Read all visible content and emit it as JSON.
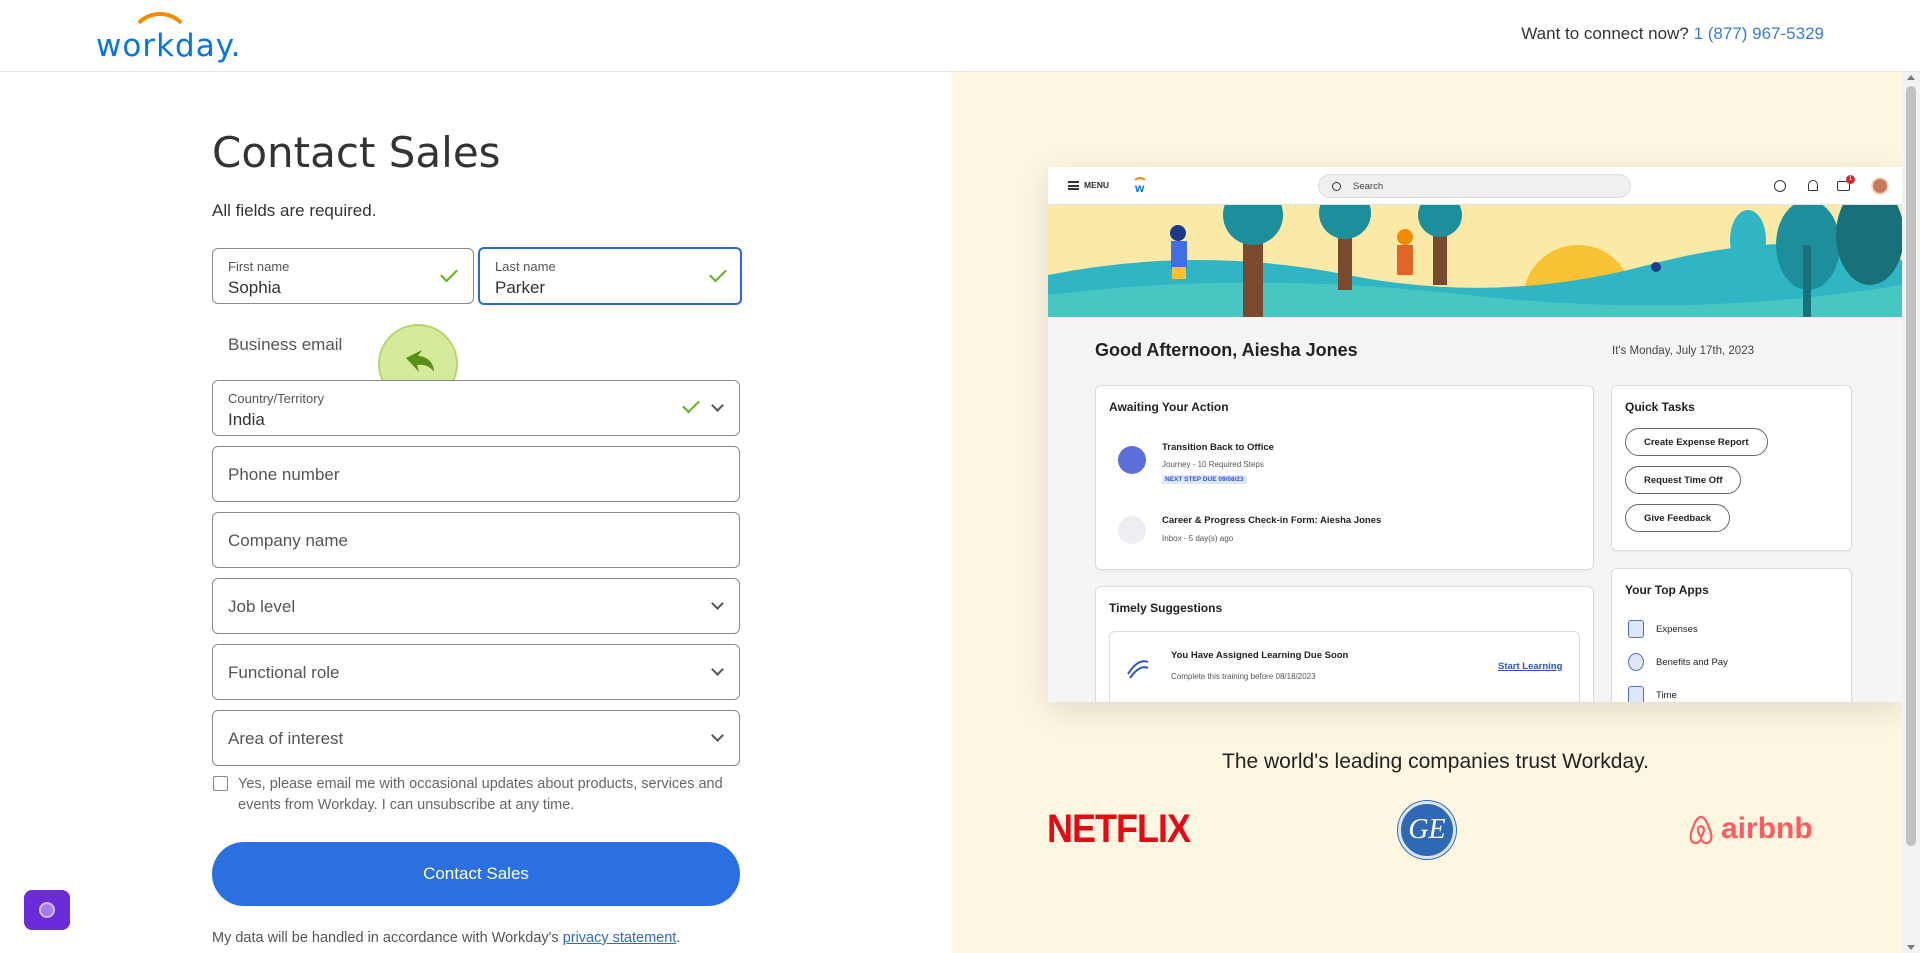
{
  "header": {
    "logo_text": "workday.",
    "connect_label": "Want to connect now?",
    "phone": "1 (877) 967-5329"
  },
  "form": {
    "title": "Contact Sales",
    "required_note": "All fields are required.",
    "first_name": {
      "label": "First name",
      "value": "Sophia"
    },
    "last_name": {
      "label": "Last name",
      "value": "Parker"
    },
    "business_email": {
      "placeholder": "Business email"
    },
    "country": {
      "label": "Country/Territory",
      "value": "India"
    },
    "phone": {
      "placeholder": "Phone number"
    },
    "company": {
      "placeholder": "Company name"
    },
    "job_level": {
      "placeholder": "Job level"
    },
    "functional_role": {
      "placeholder": "Functional role"
    },
    "area_of_interest": {
      "placeholder": "Area of interest"
    },
    "consent": "Yes, please email me with occasional updates about products, services and events from Workday. I can unsubscribe at any time.",
    "submit_label": "Contact Sales",
    "privacy_prefix": "My data will be handled in accordance with Workday's",
    "privacy_link": "privacy statement",
    "privacy_suffix": "."
  },
  "mock": {
    "menu_label": "MENU",
    "search_placeholder": "Search",
    "notification_badge": "1",
    "greeting": "Good Afternoon, Aiesha Jones",
    "date": "It's Monday, July 17th, 2023",
    "awaiting": {
      "title": "Awaiting Your Action",
      "items": [
        {
          "title": "Transition Back to Office",
          "sub": "Journey - 10 Required Steps",
          "tag": "NEXT STEP DUE 09/08/23"
        },
        {
          "title": "Career & Progress Check-in Form: Aiesha Jones",
          "sub": "Inbox - 5 day(s) ago"
        }
      ]
    },
    "quick_tasks": {
      "title": "Quick Tasks",
      "buttons": [
        "Create Expense Report",
        "Request Time Off",
        "Give Feedback"
      ]
    },
    "timely": {
      "title": "Timely Suggestions",
      "item_title": "You Have Assigned Learning Due Soon",
      "item_sub": "Complete this training before 08/18/2023",
      "link": "Start Learning"
    },
    "top_apps": {
      "title": "Your Top Apps",
      "apps": [
        "Expenses",
        "Benefits and Pay",
        "Time"
      ]
    }
  },
  "trust": {
    "headline": "The world's leading companies trust Workday.",
    "logos": {
      "netflix": "NETFLIX",
      "ge": "GE",
      "airbnb": "airbnb"
    }
  },
  "colors": {
    "primary": "#2b6fe0",
    "check_green": "#5eb31e",
    "right_bg": "#fdf7e2",
    "workday_blue": "#0875e1",
    "workday_orange": "#f38b00"
  }
}
